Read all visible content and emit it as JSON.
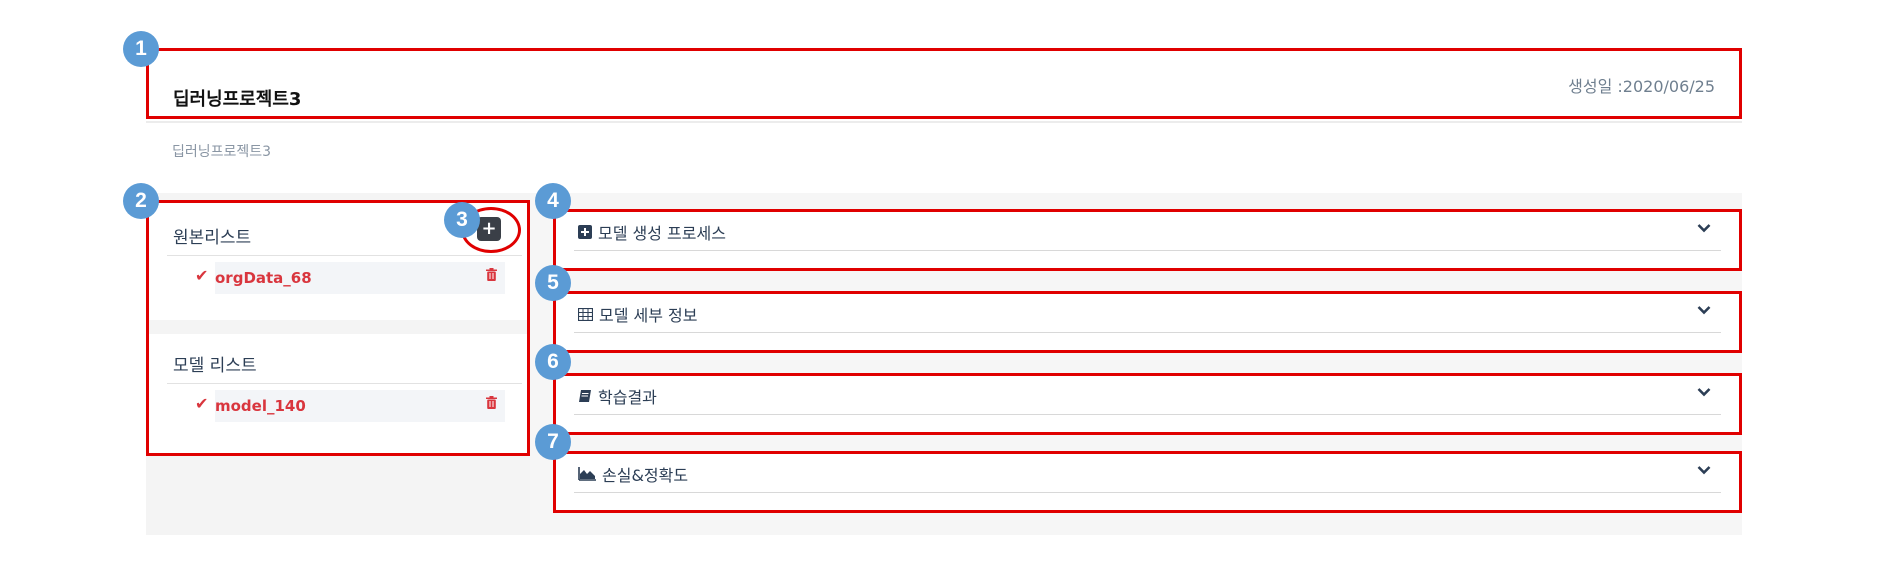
{
  "header": {
    "project_title": "딥러닝프로젝트3",
    "created_date": "생성일 :2020/06/25",
    "sub_title": "딥러닝프로젝트3"
  },
  "left_panel": {
    "original_list": {
      "heading": "원본리스트",
      "add_icon": "plus-icon",
      "items": [
        {
          "label": "orgData_68"
        }
      ]
    },
    "model_list": {
      "heading": "모델 리스트",
      "items": [
        {
          "label": "model_140"
        }
      ]
    }
  },
  "accordions": [
    {
      "label": "모델 생성 프로세스",
      "icon": "plus-square-icon"
    },
    {
      "label": "모델 세부 정보",
      "icon": "table-icon"
    },
    {
      "label": "학습결과",
      "icon": "book-icon"
    },
    {
      "label": "손실&정확도",
      "icon": "area-chart-icon"
    }
  ],
  "badges": [
    "1",
    "2",
    "3",
    "4",
    "5",
    "6",
    "7"
  ],
  "colors": {
    "annotation_red": "#e00000",
    "badge_blue": "#5b9bd5",
    "item_red": "#d9363e",
    "heading_navy": "#2c3e55"
  }
}
